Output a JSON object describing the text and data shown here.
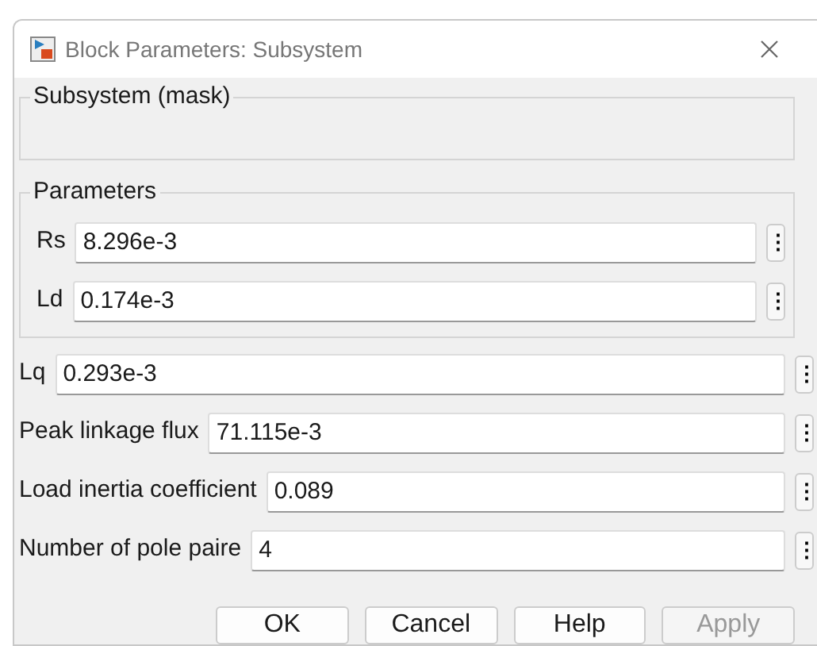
{
  "window": {
    "title": "Block Parameters: Subsystem"
  },
  "mask_group": {
    "title": "Subsystem (mask)"
  },
  "parameters_group": {
    "title": "Parameters",
    "fields": [
      {
        "label": "Rs",
        "value": "8.296e-3",
        "menu": "⋮"
      },
      {
        "label": "Ld",
        "value": "0.174e-3",
        "menu": "⋮"
      }
    ]
  },
  "fields": [
    {
      "label": "Lq",
      "value": "0.293e-3",
      "menu": "⋮"
    },
    {
      "label": "Peak linkage flux",
      "value": "71.115e-3",
      "menu": "⋮"
    },
    {
      "label": "Load inertia coefficient",
      "value": "0.089",
      "menu": "⋮"
    },
    {
      "label": "Number of pole paire",
      "value": "4",
      "menu": "⋮"
    }
  ],
  "buttons": [
    {
      "label": "OK",
      "disabled": false
    },
    {
      "label": "Cancel",
      "disabled": false
    },
    {
      "label": "Help",
      "disabled": false
    },
    {
      "label": "Apply",
      "disabled": true
    }
  ]
}
